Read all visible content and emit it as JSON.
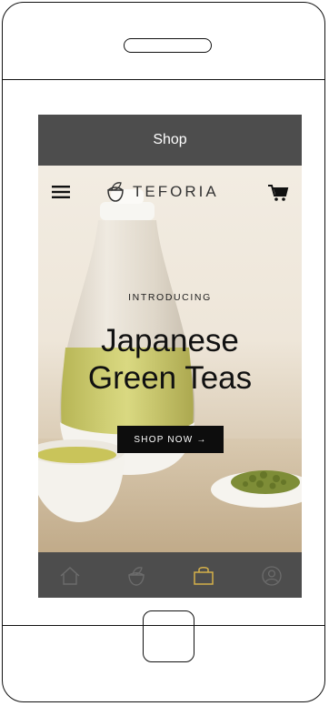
{
  "status_bar": {
    "title": "Shop"
  },
  "top_nav": {
    "brand": "TEFORIA",
    "icons": [
      "hamburger-menu-icon",
      "teforia-logo-icon",
      "cart-icon"
    ]
  },
  "hero": {
    "eyebrow": "INTRODUCING",
    "headline_line1": "Japanese",
    "headline_line2": "Green Teas",
    "cta_label": "SHOP NOW →"
  },
  "tab_bar": {
    "tabs": [
      {
        "name": "home",
        "icon": "home-icon",
        "active": false
      },
      {
        "name": "brew",
        "icon": "leaf-bowl-icon",
        "active": false
      },
      {
        "name": "shop",
        "icon": "shopping-bag-icon",
        "active": true
      },
      {
        "name": "profile",
        "icon": "profile-icon",
        "active": false
      }
    ],
    "active_color": "#d4b04a",
    "inactive_color": "#6c6c6c"
  }
}
